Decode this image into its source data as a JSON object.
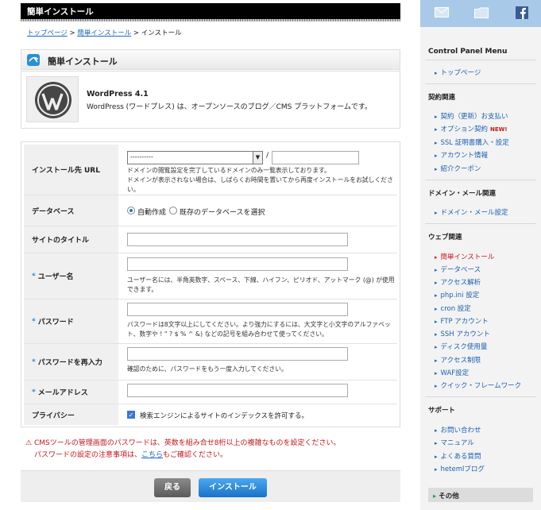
{
  "title_bar": "簡単インストール",
  "breadcrumb": {
    "top": "トップページ",
    "sep1": " > ",
    "easy": "簡単インストール",
    "sep2": " > ",
    "current": "インストール"
  },
  "heading": "簡単インストール",
  "app": {
    "name": "WordPress 4.1",
    "description": "WordPress (ワードプレス) は、オープンソースのブログ／CMS プラットフォームです。"
  },
  "form": {
    "url": {
      "label": "インストール先 URL",
      "select_value": "----------",
      "slash": "/",
      "note1": "ドメインの閲覧設定を完了しているドメインのみ一覧表示しております。",
      "note2": "ドメインが表示されない場合は、しばらくお時間を置いてから再度インストールをお試しくださ",
      "note3": "い。"
    },
    "database": {
      "label": "データベース",
      "option_auto": "自動作成",
      "option_existing": "既存のデータベースを選択"
    },
    "site_title": {
      "label": "サイトのタイトル"
    },
    "username": {
      "label": "ユーザー名",
      "required": "*",
      "note1": "ユーザー名には、半角英数字、スペース、下線、ハイフン、ピリオド、アットマーク (@) が使用",
      "note2": "できます。"
    },
    "password": {
      "label": "パスワード",
      "required": "*",
      "note1": "パスワードは8文字以上にしてください。より強力にするには、大文字と小文字のアルファベッ",
      "note2": "ト、数字や ! \" ? $ % ^ &) などの記号を組み合わせて使ってください。"
    },
    "password_confirm": {
      "label": "パスワードを再入力",
      "required": "*",
      "note": "確認のために、パスワードをもう一度入力してください。"
    },
    "email": {
      "label": "メールアドレス",
      "required": "*"
    },
    "privacy": {
      "label": "プライバシー",
      "check_label": "検索エンジンによるサイトのインデックスを許可する。"
    }
  },
  "warning": {
    "line1": "CMSツールの管理画面のパスワードは、英数を組み合せ8桁以上の複雑なものを設定ください。",
    "line2_pre": "パスワードの設定の注意事項は、",
    "line2_link": "こちら",
    "line2_post": "もご確認ください。"
  },
  "buttons": {
    "back": "戻る",
    "install": "インストール"
  },
  "sidebar": {
    "title": "Control Panel Menu",
    "top_link": "トップページ",
    "sec_contract": "契約関連",
    "contract": [
      "契約（更新）お支払い",
      "オプション契約",
      "SSL 証明書購入・設定",
      "アカウント情報",
      "紹介クーポン"
    ],
    "new_tag": "NEW!",
    "sec_domain": "ドメイン・メール関連",
    "domain": [
      "ドメイン・メール設定"
    ],
    "sec_web": "ウェブ関連",
    "web": [
      "簡単インストール",
      "データベース",
      "アクセス解析",
      "php.ini 設定",
      "cron 設定",
      "FTP アカウント",
      "SSH アカウント",
      "ディスク使用量",
      "アクセス制限",
      "WAF設定",
      "クイック・フレームワーク"
    ],
    "sec_support": "サポート",
    "support": [
      "お問い合わせ",
      "マニュアル",
      "よくある質問",
      "hetemlブログ"
    ],
    "other": "その他"
  },
  "colors": {
    "accent": "#2a8ad6",
    "warning": "#c5161d",
    "link": "#1a66c4"
  }
}
